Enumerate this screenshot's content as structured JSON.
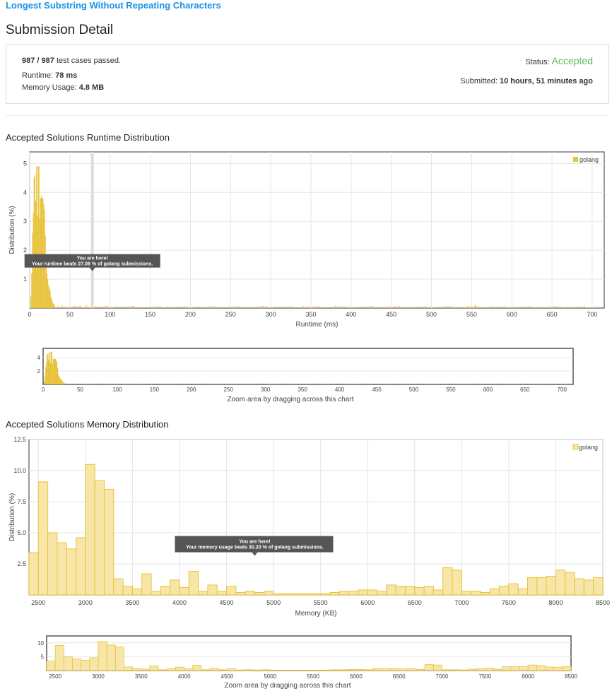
{
  "problem_title": "Longest Substring Without Repeating Characters",
  "page_heading": "Submission Detail",
  "detail": {
    "cases_passed": "987 / 987",
    "cases_text": "test cases passed.",
    "runtime_label": "Runtime:",
    "runtime_value": "78 ms",
    "memory_label": "Memory Usage:",
    "memory_value": "4.8 MB",
    "status_label": "Status:",
    "status_value": "Accepted",
    "submitted_label": "Submitted:",
    "submitted_value": "10 hours, 51 minutes ago"
  },
  "colors": {
    "accent_link": "#1a90e8",
    "accepted": "#5cb85c",
    "runtime_bar": "#e8c33c",
    "memory_bar": "#f8e6a8",
    "memory_border": "#e8c33c"
  },
  "runtime_section": {
    "heading": "Accepted Solutions Runtime Distribution",
    "ylabel": "Distribution (%)",
    "xlabel": "Runtime (ms)",
    "legend": "golang",
    "tooltip_line1": "You are here!",
    "tooltip_line2": "Your runtime beats 27.08 % of golang submissions.",
    "zoom_label": "Zoom area by dragging across this chart"
  },
  "memory_section": {
    "heading": "Accepted Solutions Memory Distribution",
    "ylabel": "Distribution (%)",
    "xlabel": "Memory (KB)",
    "legend": "golang",
    "tooltip_line1": "You are here!",
    "tooltip_line2": "Your memory usage beats 30.20 % of golang submissions.",
    "zoom_label": "Zoom area by dragging across this chart"
  },
  "chart_data": [
    {
      "type": "bar",
      "title": "Accepted Solutions Runtime Distribution",
      "xlabel": "Runtime (ms)",
      "ylabel": "Distribution (%)",
      "series_name": "golang",
      "xlim": [
        0,
        715
      ],
      "ylim": [
        0,
        5.4
      ],
      "xticks": [
        0,
        50,
        100,
        150,
        200,
        250,
        300,
        350,
        400,
        450,
        500,
        550,
        600,
        650,
        700
      ],
      "yticks": [
        1,
        2,
        3,
        4,
        5
      ],
      "highlight_x": 78,
      "bar_width": 1,
      "values_xy": [
        [
          1,
          0.4
        ],
        [
          2,
          1.2
        ],
        [
          3,
          2.6
        ],
        [
          4,
          3.3
        ],
        [
          5,
          4.5
        ],
        [
          6,
          4.6
        ],
        [
          7,
          3.7
        ],
        [
          8,
          4.9
        ],
        [
          9,
          3.2
        ],
        [
          10,
          4.9
        ],
        [
          11,
          4.9
        ],
        [
          12,
          3.1
        ],
        [
          13,
          3.8
        ],
        [
          14,
          3.9
        ],
        [
          15,
          3.8
        ],
        [
          16,
          3.8
        ],
        [
          17,
          3.6
        ],
        [
          18,
          3.4
        ],
        [
          19,
          2.5
        ],
        [
          20,
          1.5
        ],
        [
          21,
          1.2
        ],
        [
          22,
          1.0
        ],
        [
          23,
          0.8
        ],
        [
          24,
          0.7
        ],
        [
          25,
          0.6
        ],
        [
          26,
          0.4
        ],
        [
          27,
          0.3
        ],
        [
          28,
          0.2
        ],
        [
          29,
          0.15
        ],
        [
          30,
          0.12
        ],
        [
          35,
          0.08
        ],
        [
          40,
          0.1
        ],
        [
          55,
          0.08
        ],
        [
          62,
          0.06
        ],
        [
          70,
          0.1
        ],
        [
          82,
          0.08
        ],
        [
          95,
          0.07
        ],
        [
          108,
          0.08
        ],
        [
          115,
          0.06
        ],
        [
          128,
          0.07
        ],
        [
          150,
          0.05
        ],
        [
          170,
          0.06
        ],
        [
          210,
          0.07
        ],
        [
          230,
          0.05
        ],
        [
          265,
          0.05
        ],
        [
          290,
          0.07
        ],
        [
          305,
          0.06
        ],
        [
          340,
          0.07
        ],
        [
          355,
          0.05
        ],
        [
          380,
          0.08
        ],
        [
          425,
          0.06
        ],
        [
          460,
          0.07
        ],
        [
          495,
          0.05
        ],
        [
          520,
          0.07
        ],
        [
          545,
          0.08
        ],
        [
          554,
          0.12
        ],
        [
          575,
          0.07
        ],
        [
          600,
          0.06
        ],
        [
          630,
          0.05
        ],
        [
          660,
          0.06
        ],
        [
          690,
          0.05
        ],
        [
          705,
          0.06
        ]
      ],
      "baseline_noise": 0.05
    },
    {
      "type": "bar",
      "title": "Accepted Solutions Memory Distribution",
      "xlabel": "Memory (KB)",
      "ylabel": "Distribution (%)",
      "series_name": "golang",
      "xlim": [
        2400,
        8500
      ],
      "ylim": [
        0,
        12.5
      ],
      "xticks": [
        2500,
        3000,
        3500,
        4000,
        4500,
        5000,
        5500,
        6000,
        6500,
        7000,
        7500,
        8000,
        8500
      ],
      "yticks": [
        2.5,
        5.0,
        7.5,
        10.0,
        12.5
      ],
      "bin_width": 100,
      "bins": [
        [
          2400,
          3.4
        ],
        [
          2500,
          9.1
        ],
        [
          2600,
          5.0
        ],
        [
          2700,
          4.2
        ],
        [
          2800,
          3.7
        ],
        [
          2900,
          4.6
        ],
        [
          3000,
          10.5
        ],
        [
          3100,
          9.2
        ],
        [
          3200,
          8.5
        ],
        [
          3300,
          1.3
        ],
        [
          3400,
          0.7
        ],
        [
          3500,
          0.5
        ],
        [
          3600,
          1.7
        ],
        [
          3700,
          0.3
        ],
        [
          3800,
          0.7
        ],
        [
          3900,
          1.2
        ],
        [
          4000,
          0.6
        ],
        [
          4100,
          1.9
        ],
        [
          4200,
          0.3
        ],
        [
          4300,
          0.8
        ],
        [
          4400,
          0.3
        ],
        [
          4500,
          0.7
        ],
        [
          4600,
          0.2
        ],
        [
          4700,
          0.3
        ],
        [
          4800,
          0.2
        ],
        [
          4900,
          0.3
        ],
        [
          5000,
          0.1
        ],
        [
          5100,
          0.1
        ],
        [
          5200,
          0.1
        ],
        [
          5300,
          0.1
        ],
        [
          5400,
          0.1
        ],
        [
          5500,
          0.1
        ],
        [
          5600,
          0.2
        ],
        [
          5700,
          0.3
        ],
        [
          5800,
          0.3
        ],
        [
          5900,
          0.4
        ],
        [
          6000,
          0.4
        ],
        [
          6100,
          0.3
        ],
        [
          6200,
          0.8
        ],
        [
          6300,
          0.7
        ],
        [
          6400,
          0.7
        ],
        [
          6500,
          0.6
        ],
        [
          6600,
          0.7
        ],
        [
          6700,
          0.4
        ],
        [
          6800,
          2.2
        ],
        [
          6900,
          2.0
        ],
        [
          7000,
          0.3
        ],
        [
          7100,
          0.3
        ],
        [
          7200,
          0.2
        ],
        [
          7300,
          0.5
        ],
        [
          7400,
          0.7
        ],
        [
          7500,
          0.9
        ],
        [
          7600,
          0.5
        ],
        [
          7700,
          1.4
        ],
        [
          7800,
          1.4
        ],
        [
          7900,
          1.5
        ],
        [
          8000,
          2.0
        ],
        [
          8100,
          1.8
        ],
        [
          8200,
          1.3
        ],
        [
          8300,
          1.2
        ],
        [
          8400,
          1.4
        ],
        [
          8500,
          1.3
        ],
        [
          8600,
          0.6
        ]
      ]
    }
  ]
}
